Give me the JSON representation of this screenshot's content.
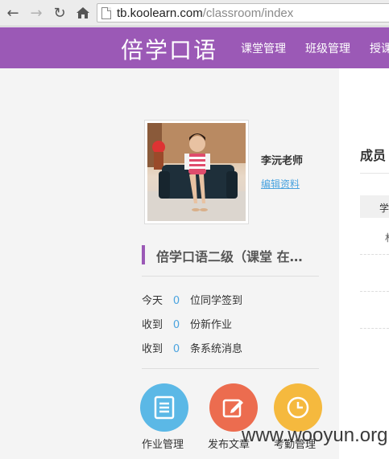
{
  "browser": {
    "url_host": "tb.koolearn.com",
    "url_path": "/classroom/index"
  },
  "header": {
    "logo": "倍学口语",
    "nav": [
      "课堂管理",
      "班级管理",
      "授课"
    ]
  },
  "profile": {
    "teacher_name": "李沅老师",
    "edit_link": "编辑资料"
  },
  "class": {
    "title": "倍学口语二级（课堂 在…"
  },
  "stats": [
    {
      "prefix": "今天",
      "value": "0",
      "suffix": "位同学签到"
    },
    {
      "prefix": "收到",
      "value": "0",
      "suffix": "份新作业"
    },
    {
      "prefix": "收到",
      "value": "0",
      "suffix": "条系统消息"
    }
  ],
  "actions": [
    {
      "label": "作业管理",
      "icon": "document-icon",
      "color": "#5bb8e6"
    },
    {
      "label": "发布文章",
      "icon": "edit-icon",
      "color": "#ec6c4f"
    },
    {
      "label": "考勤管理",
      "icon": "clock-icon",
      "color": "#f5b93e"
    }
  ],
  "members_panel": {
    "title": "成员",
    "header_cell": "学",
    "row_cell": "林"
  },
  "watermark": "www.wooyun.org"
}
